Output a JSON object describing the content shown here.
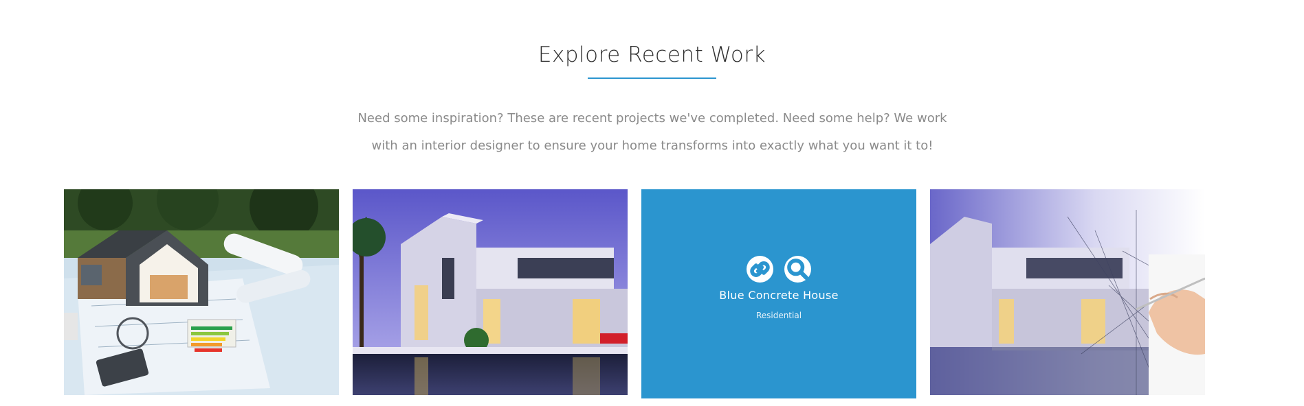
{
  "section": {
    "title": "Explore Recent Work",
    "intro_line1": "Need some inspiration? These are recent projects we've completed. Need some help? We work",
    "intro_line2": "with an interior designer to ensure your home transforms into exactly what you want it to!"
  },
  "portfolio": {
    "items": [
      {
        "image": "house-model-on-blueprints"
      },
      {
        "image": "modern-white-villa-at-dusk"
      },
      {
        "image": "blue-concrete-house",
        "title": "Blue Concrete House",
        "category": "Residential",
        "icons": [
          "link-icon",
          "search-icon"
        ]
      },
      {
        "image": "villa-sketch-with-hand"
      }
    ]
  },
  "colors": {
    "accent": "#2b95cf",
    "heading": "#2f2f2f",
    "body_text": "#8a8a8a",
    "background": "#ffffff"
  }
}
